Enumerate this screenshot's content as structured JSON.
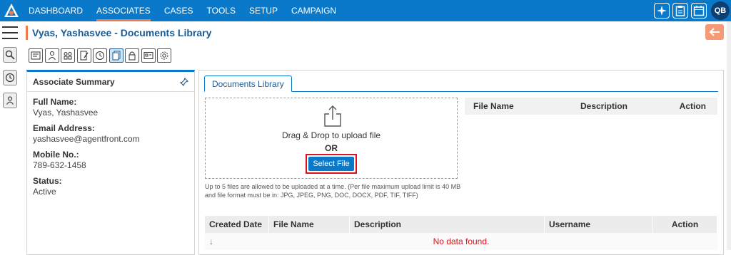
{
  "topbar": {
    "nav": [
      "DASHBOARD",
      "ASSOCIATES",
      "CASES",
      "TOOLS",
      "SETUP",
      "CAMPAIGN"
    ],
    "active_index": 1,
    "avatar": "QB",
    "colors": {
      "bar": "#0b79c9",
      "accent": "#f37b4b"
    }
  },
  "header": {
    "title": "Vyas, Yashasvee - Documents Library"
  },
  "summary": {
    "title": "Associate Summary",
    "fields": [
      {
        "label": "Full Name:",
        "value": "Vyas, Yashasvee"
      },
      {
        "label": "Email Address:",
        "value": "yashasvee@agentfront.com"
      },
      {
        "label": "Mobile No.:",
        "value": "789-632-1458"
      },
      {
        "label": "Status:",
        "value": "Active"
      }
    ]
  },
  "main": {
    "tab": "Documents Library",
    "upload": {
      "drag_text": "Drag & Drop to upload file",
      "or_text": "OR",
      "button": "Select File",
      "note": "Up to 5 files are allowed to be uploaded at a time. (Per file maximum upload limit is 40 MB and file format must be in: JPG, JPEG, PNG, DOC, DOCX, PDF, TIF, TIFF)"
    },
    "file_table": {
      "columns": [
        "File Name",
        "Description",
        "Action"
      ]
    },
    "docs_table": {
      "columns": [
        "Created Date",
        "File Name",
        "Description",
        "Username",
        "Action"
      ],
      "empty": "No data found."
    }
  }
}
